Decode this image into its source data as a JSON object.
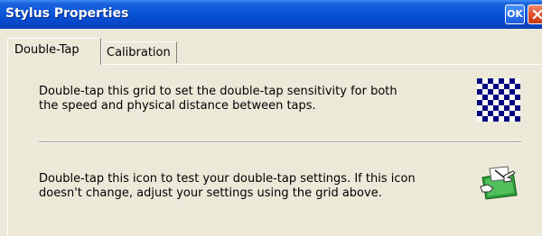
{
  "window": {
    "title": "Stylus Properties",
    "ok_label": "OK"
  },
  "tabs": [
    {
      "label": "Double-Tap",
      "active": true
    },
    {
      "label": "Calibration",
      "active": false
    }
  ],
  "double_tap": {
    "grid_text_line1": "Double-tap this grid to set the double-tap sensitivity for both",
    "grid_text_line2": "the speed and physical distance between taps.",
    "test_text_line1": "Double-tap this icon to test your double-tap settings. If this icon",
    "test_text_line2": "doesn't change, adjust your settings using the grid above."
  },
  "icons": {
    "grid": "checkerboard-grid-icon",
    "test": "hand-tap-test-icon",
    "close": "close-icon"
  },
  "colors": {
    "titlebar": "#0a55d9",
    "face": "#ece9d8",
    "close": "#e0502a",
    "grid_dark": "#000080"
  }
}
